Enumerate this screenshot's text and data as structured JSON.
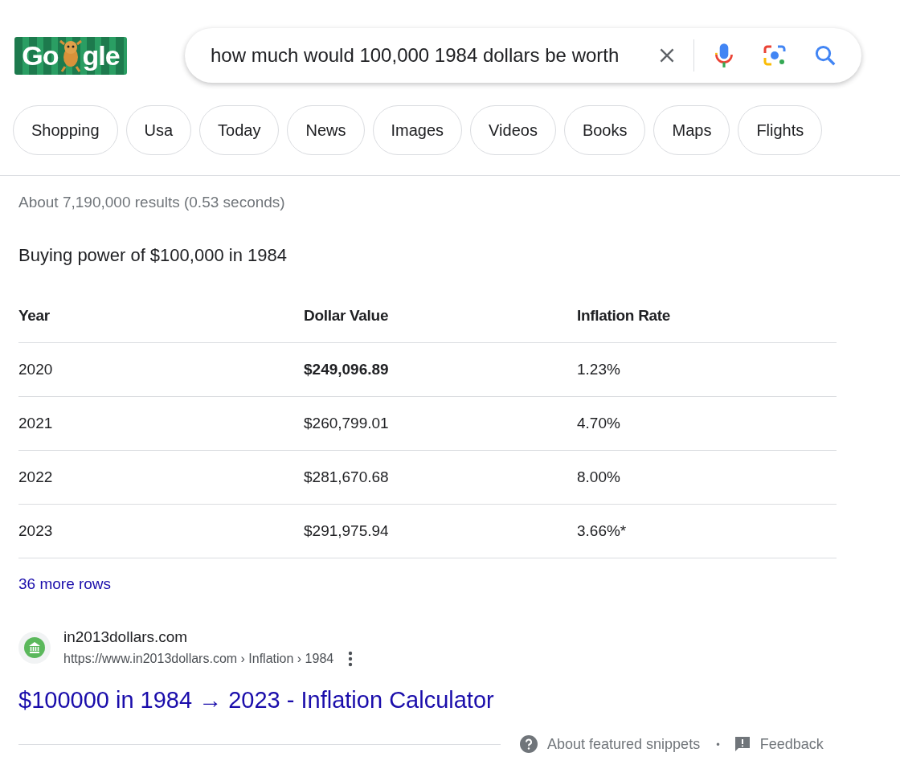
{
  "logo": {
    "text_start": "Go",
    "text_end": "gle"
  },
  "search": {
    "value": "how much would 100,000 1984 dollars be worth"
  },
  "chips": [
    {
      "label": "Shopping",
      "selected": false
    },
    {
      "label": "Usa",
      "selected": false
    },
    {
      "label": "Today",
      "selected": false
    },
    {
      "label": "News",
      "selected": false
    },
    {
      "label": "Images",
      "selected": false
    },
    {
      "label": "Videos",
      "selected": false
    },
    {
      "label": "Books",
      "selected": false
    },
    {
      "label": "Maps",
      "selected": false
    },
    {
      "label": "Flights",
      "selected": false
    }
  ],
  "result_stats": "About 7,190,000 results (0.53 seconds)",
  "snippet": {
    "heading": "Buying power of $100,000 in 1984",
    "table": {
      "columns": [
        "Year",
        "Dollar Value",
        "Inflation Rate"
      ],
      "rows": [
        {
          "cells": [
            "2020",
            "$249,096.89",
            "1.23%"
          ],
          "highlighted": true
        },
        {
          "cells": [
            "2021",
            "$260,799.01",
            "4.70%"
          ],
          "highlighted": false
        },
        {
          "cells": [
            "2022",
            "$281,670.68",
            "8.00%"
          ],
          "highlighted": false
        },
        {
          "cells": [
            "2023",
            "$291,975.94",
            "3.66%*"
          ],
          "highlighted": false
        }
      ]
    },
    "more_rows": "36 more rows",
    "source": {
      "site": "in2013dollars.com",
      "url": "https://www.in2013dollars.com › Inflation › 1984",
      "title": "$100000 in 1984 → 2023 - Inflation Calculator"
    }
  },
  "footer": {
    "about": "About featured snippets",
    "separator": "•",
    "feedback": "Feedback"
  }
}
